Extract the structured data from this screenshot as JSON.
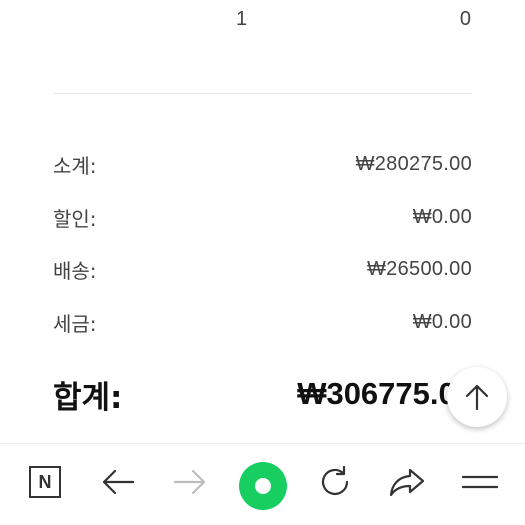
{
  "order_line": {
    "quantity": "1",
    "price": "0"
  },
  "summary": {
    "subtotal": {
      "label": "소계:",
      "value": "₩280275.00"
    },
    "discount": {
      "label": "할인:",
      "value": "₩0.00"
    },
    "shipping": {
      "label": "배송:",
      "value": "₩26500.00"
    },
    "tax": {
      "label": "세금:",
      "value": "₩0.00"
    },
    "total": {
      "label": "합계:",
      "value": "₩306775.00"
    }
  },
  "scroll_top": {
    "icon": "arrow-up-icon"
  },
  "browser_toolbar": {
    "logo_letter": "N",
    "items": [
      {
        "name": "naver-logo-button",
        "icon": "n-logo-icon"
      },
      {
        "name": "back-button",
        "icon": "arrow-left-icon"
      },
      {
        "name": "forward-button",
        "icon": "arrow-right-icon",
        "disabled": true
      },
      {
        "name": "green-dot-button",
        "icon": "green-dot-icon"
      },
      {
        "name": "refresh-button",
        "icon": "refresh-icon"
      },
      {
        "name": "share-button",
        "icon": "share-icon"
      },
      {
        "name": "menu-button",
        "icon": "menu-icon"
      }
    ],
    "colors": {
      "icon": "#333333",
      "icon_disabled": "#bdbdbd",
      "green": "#19ce60"
    }
  }
}
